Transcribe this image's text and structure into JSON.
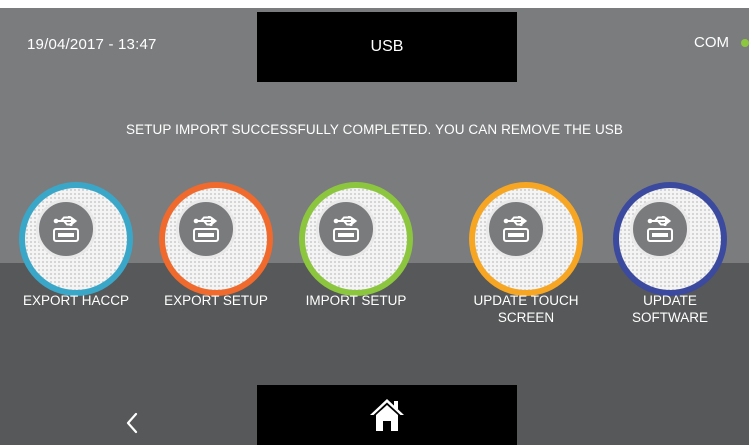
{
  "header": {
    "datetime": "19/04/2017 - 13:47",
    "title": "USB",
    "status_label": "COM",
    "status_color": "#8dc63f"
  },
  "message": "SETUP IMPORT SUCCESSFULLY COMPLETED. YOU CAN REMOVE THE USB",
  "buttons": [
    {
      "label_line1": "EXPORT HACCP",
      "label_line2": "",
      "ring_color": "#3aa7c9",
      "icon": "usb-icon"
    },
    {
      "label_line1": "EXPORT SETUP",
      "label_line2": "",
      "ring_color": "#ef6a2c",
      "icon": "usb-icon"
    },
    {
      "label_line1": "IMPORT SETUP",
      "label_line2": "",
      "ring_color": "#8cc63e",
      "icon": "usb-icon"
    },
    {
      "label_line1": "UPDATE TOUCH",
      "label_line2": "SCREEN",
      "ring_color": "#f6a623",
      "icon": "usb-icon"
    },
    {
      "label_line1": "UPDATE",
      "label_line2": "SOFTWARE",
      "ring_color": "#3b4a9e",
      "icon": "usb-icon"
    }
  ],
  "footer": {
    "back_icon": "chevron-left-icon",
    "home_icon": "home-icon"
  }
}
